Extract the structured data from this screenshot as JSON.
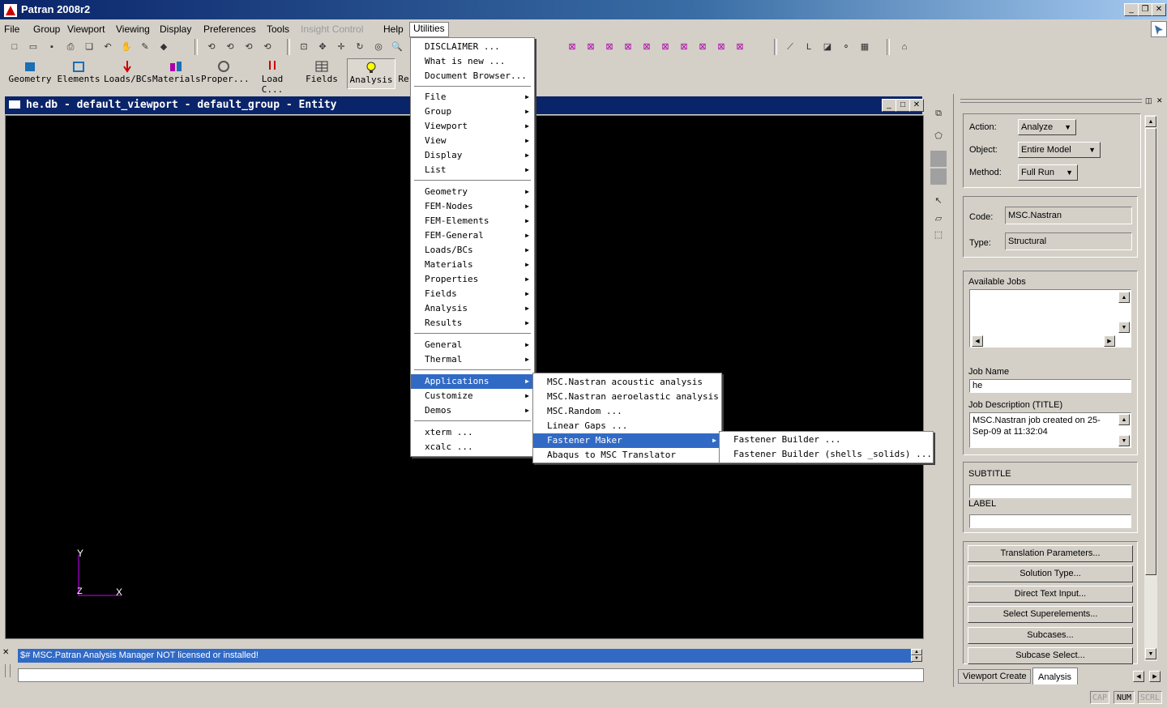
{
  "window": {
    "title": "Patran 2008r2"
  },
  "menubar": {
    "items": [
      "File",
      "Group",
      "Viewport",
      "Viewing",
      "Display",
      "Preferences",
      "Tools",
      "Insight Control",
      "Help",
      "Utilities"
    ]
  },
  "app_buttons": [
    "Geometry",
    "Elements",
    "Loads/BCs",
    "Materials",
    "Proper...",
    "Load C...",
    "Fields",
    "Analysis",
    "Re"
  ],
  "viewport": {
    "title": "he.db - default_viewport - default_group - Entity",
    "axes": {
      "y": "Y",
      "x": "X",
      "z": "Z"
    }
  },
  "utilities_menu": {
    "items": [
      {
        "label": "DISCLAIMER ..."
      },
      {
        "label": "What is new ..."
      },
      {
        "label": "Document Browser..."
      },
      {
        "label": "File",
        "submenu": true
      },
      {
        "label": "Group",
        "submenu": true
      },
      {
        "label": "Viewport",
        "submenu": true
      },
      {
        "label": "View",
        "submenu": true
      },
      {
        "label": "Display",
        "submenu": true
      },
      {
        "label": "List",
        "submenu": true
      },
      {
        "label": "Geometry",
        "submenu": true
      },
      {
        "label": "FEM-Nodes",
        "submenu": true
      },
      {
        "label": "FEM-Elements",
        "submenu": true
      },
      {
        "label": "FEM-General",
        "submenu": true
      },
      {
        "label": "Loads/BCs",
        "submenu": true
      },
      {
        "label": "Materials",
        "submenu": true
      },
      {
        "label": "Properties",
        "submenu": true
      },
      {
        "label": "Fields",
        "submenu": true
      },
      {
        "label": "Analysis",
        "submenu": true
      },
      {
        "label": "Results",
        "submenu": true
      },
      {
        "label": "General",
        "submenu": true
      },
      {
        "label": "Thermal",
        "submenu": true
      },
      {
        "label": "Applications",
        "submenu": true,
        "selected": true
      },
      {
        "label": "Customize",
        "submenu": true
      },
      {
        "label": "Demos",
        "submenu": true
      },
      {
        "label": "xterm ..."
      },
      {
        "label": "xcalc ..."
      }
    ]
  },
  "applications_menu": {
    "items": [
      {
        "label": "MSC.Nastran acoustic analysis"
      },
      {
        "label": "MSC.Nastran aeroelastic analysis"
      },
      {
        "label": "MSC.Random ..."
      },
      {
        "label": "Linear Gaps ..."
      },
      {
        "label": "Fastener Maker",
        "submenu": true,
        "selected": true
      },
      {
        "label": "Abaqus to MSC Translator"
      }
    ]
  },
  "fastener_menu": {
    "items": [
      {
        "label": "Fastener Builder ..."
      },
      {
        "label": "Fastener Builder (shells _solids) ..."
      }
    ]
  },
  "analysis_panel": {
    "action_label": "Action:",
    "action_value": "Analyze",
    "object_label": "Object:",
    "object_value": "Entire Model",
    "method_label": "Method:",
    "method_value": "Full Run",
    "code_label": "Code:",
    "code_value": "MSC.Nastran",
    "type_label": "Type:",
    "type_value": "Structural",
    "available_jobs_label": "Available Jobs",
    "job_name_label": "Job Name",
    "job_name_value": "he",
    "job_desc_label": "Job Description (TITLE)",
    "job_desc_value": "MSC.Nastran job created on 25-Sep-09 at 11:32:04",
    "subtitle_label": "SUBTITLE",
    "label_label": "LABEL",
    "buttons": [
      "Translation Parameters...",
      "Solution Type...",
      "Direct Text Input...",
      "Select Superelements...",
      "Subcases...",
      "Subcase Select..."
    ],
    "tabs": [
      "Viewport Create",
      "Analysis"
    ]
  },
  "command": {
    "history": "$# MSC.Patran Analysis Manager NOT licensed or installed!"
  },
  "status": [
    "CAP",
    "NUM",
    "SCRL"
  ]
}
